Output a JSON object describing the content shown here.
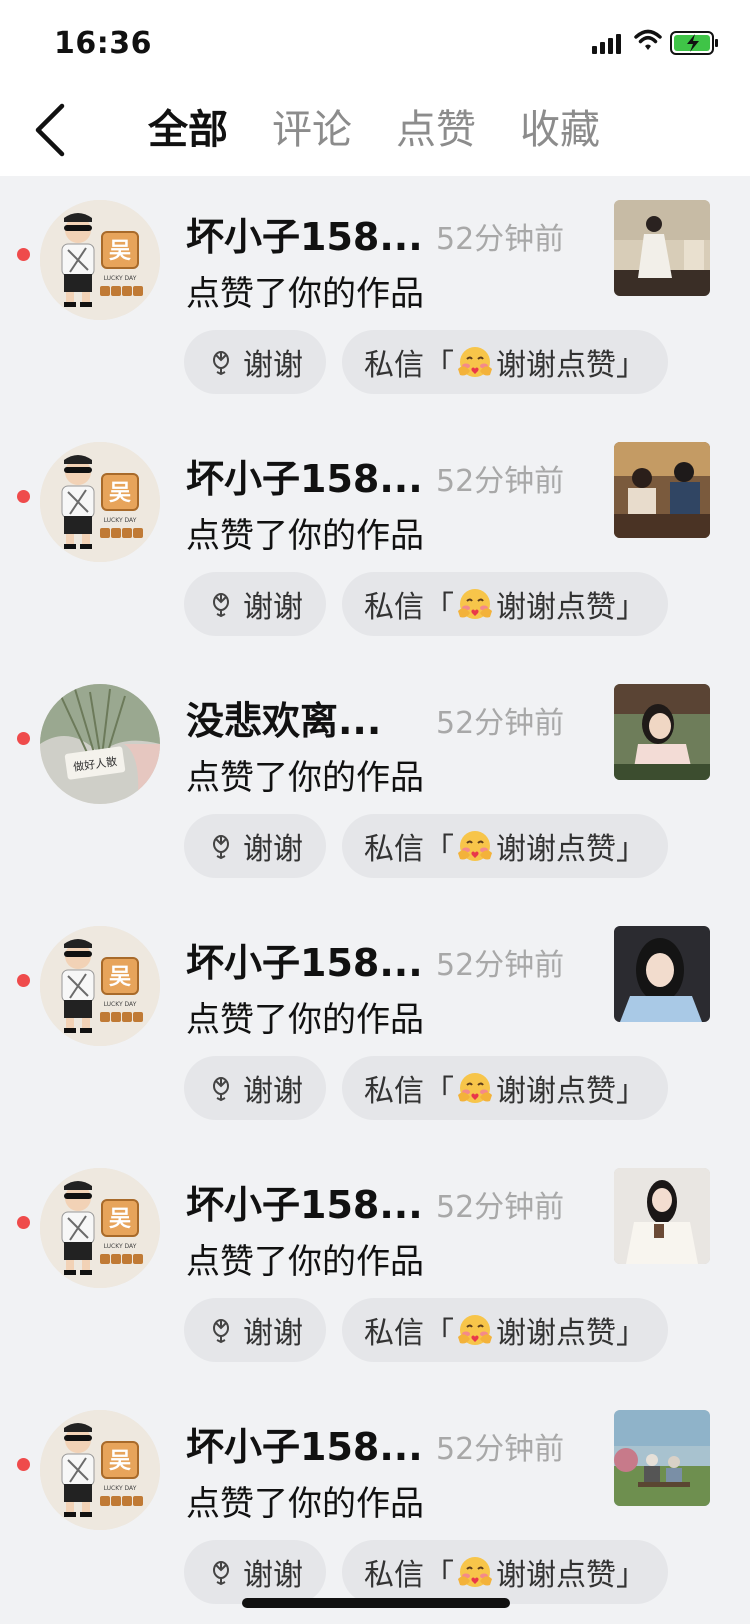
{
  "status_bar": {
    "time": "16:36",
    "icons": [
      "cellular-signal-icon",
      "wifi-icon",
      "battery-charging-icon"
    ]
  },
  "header": {
    "back_icon": "chevron-left-icon",
    "tabs": [
      {
        "label": "全部",
        "active": true
      },
      {
        "label": "评论",
        "active": false
      },
      {
        "label": "点赞",
        "active": false
      },
      {
        "label": "收藏",
        "active": false
      }
    ]
  },
  "items": [
    {
      "username": "坏小子158...",
      "time": "52分钟前",
      "action": "点赞了你的作品",
      "thanks_label": "谢谢",
      "dm_prefix": "私信「",
      "dm_suffix": "谢谢点赞」",
      "avatar": "boy-sunglasses",
      "thumbnail": "woman-white-dress"
    },
    {
      "username": "坏小子158...",
      "time": "52分钟前",
      "action": "点赞了你的作品",
      "thanks_label": "谢谢",
      "dm_prefix": "私信「",
      "dm_suffix": "谢谢点赞」",
      "avatar": "boy-sunglasses",
      "thumbnail": "couple-cafe"
    },
    {
      "username": "没悲欢离...",
      "time": "52分钟前",
      "action": "点赞了你的作品",
      "thanks_label": "谢谢",
      "dm_prefix": "私信「",
      "dm_suffix": "谢谢点赞」",
      "avatar": "flowers-card",
      "avatar_text": "做好人散",
      "thumbnail": "woman-smiling"
    },
    {
      "username": "坏小子158...",
      "time": "52分钟前",
      "action": "点赞了你的作品",
      "thanks_label": "谢谢",
      "dm_prefix": "私信「",
      "dm_suffix": "谢谢点赞」",
      "avatar": "boy-sunglasses",
      "thumbnail": "woman-car-selfie"
    },
    {
      "username": "坏小子158...",
      "time": "52分钟前",
      "action": "点赞了你的作品",
      "thanks_label": "谢谢",
      "dm_prefix": "私信「",
      "dm_suffix": "谢谢点赞」",
      "avatar": "boy-sunglasses",
      "thumbnail": "woman-white-sweater"
    },
    {
      "username": "坏小子158...",
      "time": "52分钟前",
      "action": "点赞了你的作品",
      "thanks_label": "谢谢",
      "dm_prefix": "私信「",
      "dm_suffix": "谢谢点赞」",
      "avatar": "boy-sunglasses",
      "thumbnail": "elderly-couple-bench"
    }
  ],
  "avatar_badge": {
    "char": "吴",
    "tagline": "LUCKY DAY",
    "bottom": "天天开心"
  },
  "colors": {
    "unread_dot": "#ef4b4b",
    "background": "#f1f2f4",
    "button_bg": "#e5e6e9",
    "timestamp": "#a8a8a8"
  }
}
